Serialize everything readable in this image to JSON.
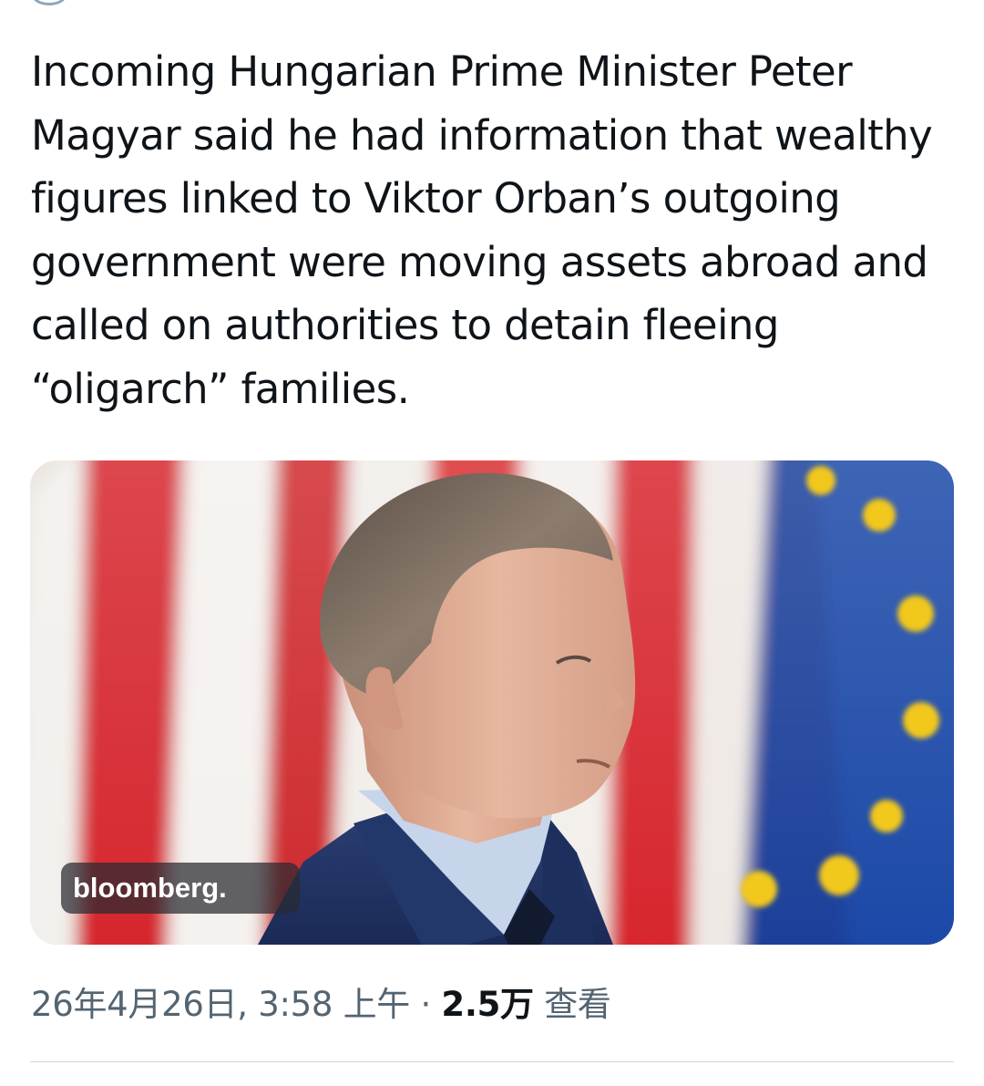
{
  "post": {
    "text": "Incoming Hungarian Prime Minister Peter Magyar said he had information that wealthy figures linked to Viktor Orban’s outgoing government were moving assets abroad and called on authorities to detain fleeing “oligarch” families.",
    "media": {
      "source_label": "bloomberg.",
      "photo_subject": "man in profile in front of Hungarian and EU flags"
    },
    "meta": {
      "timestamp": "26年4月26日, 3:58 上午",
      "separator": " · ",
      "views_count": "2.5万",
      "views_label": " 查看"
    }
  },
  "colors": {
    "text": "#0f1419",
    "meta_gray": "#536471",
    "link_blue": "#1d9bf0",
    "divider": "#cfd9de",
    "flag_red": "#d6262e",
    "eu_blue": "#1a3f9a",
    "eu_star": "#f2c81c"
  }
}
